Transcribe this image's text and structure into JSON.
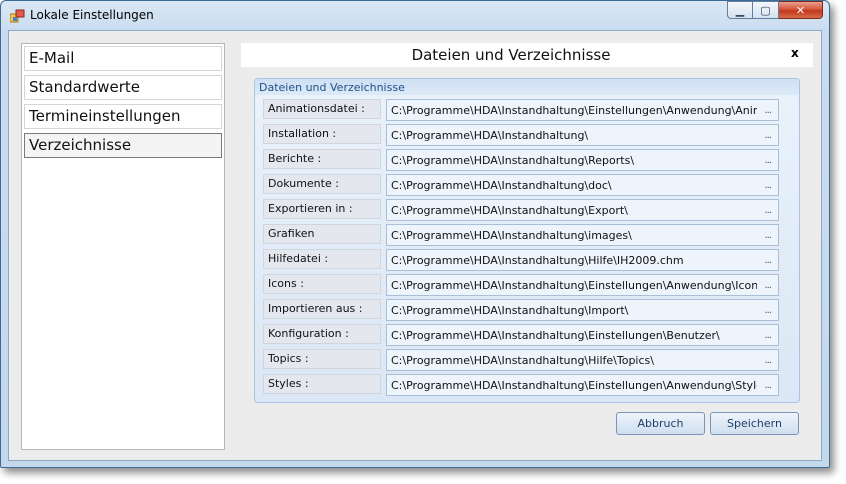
{
  "window": {
    "title": "Lokale Einstellungen",
    "minimize_glyph": "▁",
    "maximize_glyph": "▢",
    "close_glyph": "✕"
  },
  "sidebar": {
    "items": [
      {
        "label": "E-Mail"
      },
      {
        "label": "Standardwerte"
      },
      {
        "label": "Termineinstellungen"
      },
      {
        "label": "Verzeichnisse",
        "selected": true
      }
    ]
  },
  "panel": {
    "title": "Dateien und Verzeichnisse",
    "close_glyph": "x"
  },
  "group": {
    "title": "Dateien und Verzeichnisse",
    "browse_label": "...",
    "rows": [
      {
        "label": "Animationsdatei :",
        "value": "C:\\Programme\\HDA\\Instandhaltung\\Einstellungen\\Anwendung\\Animatio"
      },
      {
        "label": "Installation :",
        "value": "C:\\Programme\\HDA\\Instandhaltung\\"
      },
      {
        "label": "Berichte :",
        "value": "C:\\Programme\\HDA\\Instandhaltung\\Reports\\"
      },
      {
        "label": "Dokumente :",
        "value": "C:\\Programme\\HDA\\Instandhaltung\\doc\\"
      },
      {
        "label": "Exportieren in :",
        "value": "C:\\Programme\\HDA\\Instandhaltung\\Export\\"
      },
      {
        "label": "Grafiken",
        "value": "C:\\Programme\\HDA\\Instandhaltung\\images\\"
      },
      {
        "label": "Hilfedatei :",
        "value": "C:\\Programme\\HDA\\Instandhaltung\\Hilfe\\IH2009.chm"
      },
      {
        "label": "Icons :",
        "value": "C:\\Programme\\HDA\\Instandhaltung\\Einstellungen\\Anwendung\\Icons\\"
      },
      {
        "label": "Importieren aus :",
        "value": "C:\\Programme\\HDA\\Instandhaltung\\Import\\"
      },
      {
        "label": "Konfiguration :",
        "value": "C:\\Programme\\HDA\\Instandhaltung\\Einstellungen\\Benutzer\\"
      },
      {
        "label": "Topics :",
        "value": "C:\\Programme\\HDA\\Instandhaltung\\Hilfe\\Topics\\"
      },
      {
        "label": "Styles :",
        "value": "C:\\Programme\\HDA\\Instandhaltung\\Einstellungen\\Anwendung\\Styles\\"
      }
    ]
  },
  "buttons": {
    "cancel": "Abbruch",
    "save": "Speichern"
  }
}
